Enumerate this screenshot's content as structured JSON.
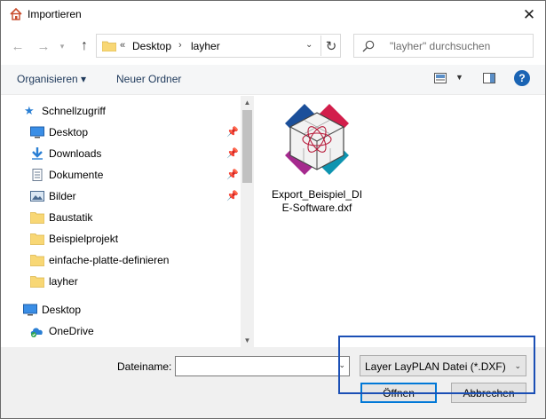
{
  "window": {
    "title": "Importieren",
    "close_symbol": "✕"
  },
  "address": {
    "overflow": "«",
    "segments": [
      "Desktop",
      "layher"
    ],
    "refresh_symbol": "↻"
  },
  "search": {
    "placeholder": "\"layher\" durchsuchen"
  },
  "toolbar": {
    "organize_label": "Organisieren ▾",
    "new_folder_label": "Neuer Ordner",
    "help_label": "?"
  },
  "navpane": {
    "quick_access": "Schnellzugriff",
    "items": [
      {
        "label": "Desktop",
        "icon": "desktop-icon",
        "pinned": true
      },
      {
        "label": "Downloads",
        "icon": "download-icon",
        "pinned": true
      },
      {
        "label": "Dokumente",
        "icon": "document-icon",
        "pinned": true
      },
      {
        "label": "Bilder",
        "icon": "pictures-icon",
        "pinned": true
      },
      {
        "label": "Baustatik",
        "icon": "folder-icon",
        "pinned": false
      },
      {
        "label": "Beispielprojekt",
        "icon": "folder-icon",
        "pinned": false
      },
      {
        "label": "einfache-platte-definieren",
        "icon": "folder-icon",
        "pinned": false
      },
      {
        "label": "layher",
        "icon": "folder-icon",
        "pinned": false
      }
    ],
    "desktop_root": "Desktop",
    "onedrive": "OneDrive"
  },
  "files": [
    {
      "name": "Export_Beispiel_DIE-Software.dxf",
      "icon": "dxf-file-icon"
    }
  ],
  "bottom": {
    "filename_label": "Dateiname:",
    "filename_value": "",
    "filter_value": "Layer LayPLAN Datei (*.DXF)",
    "open_label": "Öffnen",
    "cancel_label": "Abbrechen"
  },
  "colors": {
    "accent": "#0078d7",
    "highlight": "#1b4fb5",
    "folder": "#f8d775"
  }
}
